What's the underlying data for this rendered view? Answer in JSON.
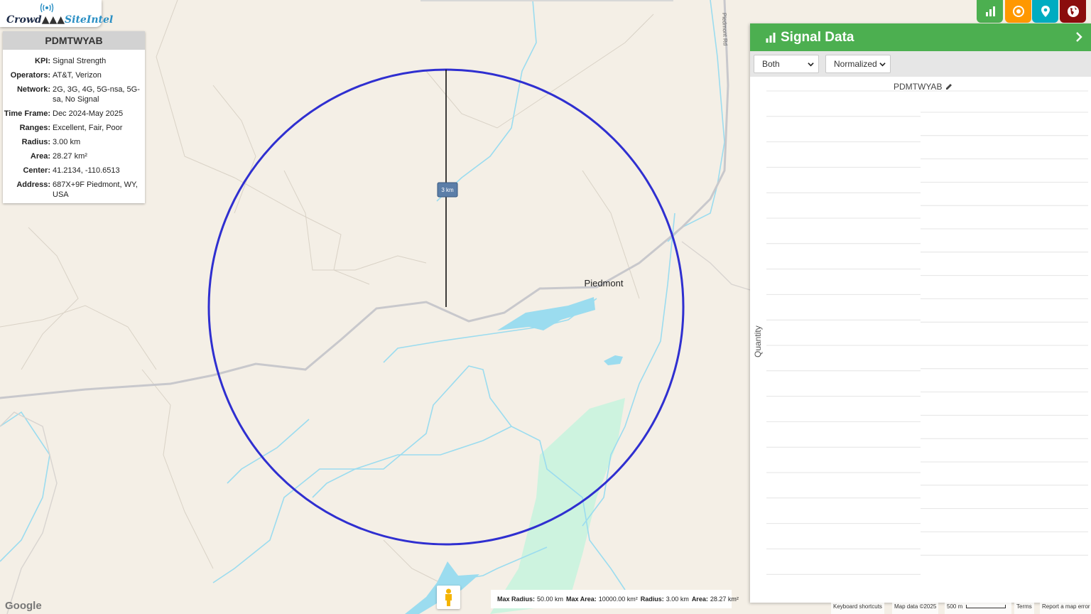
{
  "app": {
    "logo_part1": "Crowd",
    "logo_part2": "SiteIntel"
  },
  "info_card": {
    "title": "PDMTWYAB",
    "rows": [
      {
        "key": "KPI:",
        "value": "Signal Strength"
      },
      {
        "key": "Operators:",
        "value": "AT&T, Verizon"
      },
      {
        "key": "Network:",
        "value": "2G, 3G, 4G, 5G-nsa, 5G-sa, No Signal"
      },
      {
        "key": "Time Frame:",
        "value": "Dec 2024-May 2025"
      },
      {
        "key": "Ranges:",
        "value": "Excellent, Fair, Poor"
      },
      {
        "key": "Radius:",
        "value": "3.00 km"
      },
      {
        "key": "Area:",
        "value": "28.27 km²"
      },
      {
        "key": "Center:",
        "value": "41.2134, -110.6513"
      },
      {
        "key": "Address:",
        "value": "687X+9F Piedmont, WY, USA"
      }
    ]
  },
  "map": {
    "place_label": "Piedmont",
    "road_label": "Piedmont Rd",
    "radius_label": "3 km",
    "circle_color": "#2f2fd0",
    "water_color": "#9bdcef",
    "park_color": "#cdf3df"
  },
  "toolbar": {
    "buttons": [
      {
        "name": "signal-data",
        "color": "#4caf50",
        "icon": "bar-chart-icon"
      },
      {
        "name": "target",
        "color": "#ff9800",
        "icon": "target-icon"
      },
      {
        "name": "location",
        "color": "#00acc1",
        "icon": "map-pin-icon"
      },
      {
        "name": "globe",
        "color": "#8b0d0d",
        "icon": "globe-icon"
      }
    ]
  },
  "panel": {
    "title": "Signal Data",
    "operator_select": "Both",
    "mode_select": "Normalized",
    "chart_name": "PDMTWYAB",
    "y_label": "Quantity"
  },
  "stats": {
    "max_radius_label": "Max Radius:",
    "max_radius_value": "50.00 km",
    "max_area_label": "Max Area:",
    "max_area_value": "10000.00 km²",
    "radius_label": "Radius:",
    "radius_value": "3.00 km",
    "area_label": "Area:",
    "area_value": "28.27 km²"
  },
  "attribution": {
    "google": "Google",
    "keyboard": "Keyboard shortcuts",
    "map_data": "Map data ©2025",
    "scale": "500 m",
    "terms": "Terms",
    "report": "Report a map error"
  }
}
